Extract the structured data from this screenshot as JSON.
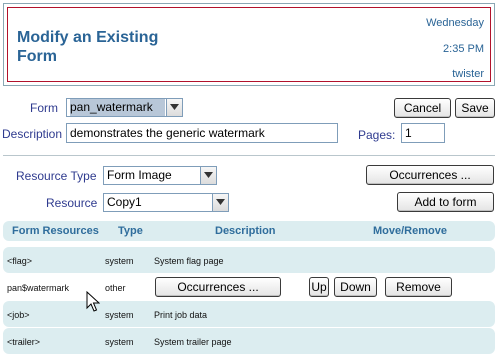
{
  "header": {
    "title": "Modify an Existing Form",
    "day": "Wednesday",
    "time": "2:35 PM",
    "host": "twister"
  },
  "form": {
    "form_label": "Form",
    "form_value": "pan_watermark",
    "description_label": "Description",
    "description_value": "demonstrates the generic watermark",
    "pages_label": "Pages:",
    "pages_value": "1",
    "cancel_label": "Cancel",
    "save_label": "Save"
  },
  "resource": {
    "type_label": "Resource Type",
    "type_value": "Form Image",
    "resource_label": "Resource",
    "resource_value": "Copy1",
    "occurrences_label": "Occurrences ...",
    "add_label": "Add to form"
  },
  "table": {
    "headers": [
      "Form Resources",
      "Type",
      "Description",
      "Move/Remove"
    ],
    "rows": [
      {
        "name": "<flag>",
        "type": "system",
        "description": "System flag page"
      },
      {
        "name": "pan$watermark",
        "type": "other",
        "occurrences_label": "Occurrences ...",
        "up_label": "Up",
        "down_label": "Down",
        "remove_label": "Remove"
      },
      {
        "name": "<job>",
        "type": "system",
        "description": "Print job data"
      },
      {
        "name": "<trailer>",
        "type": "system",
        "description": "System trailer page"
      }
    ]
  },
  "colors": {
    "accent": "#2a6496",
    "header_border": "#b1122c",
    "table_band": "#dcedf0"
  }
}
